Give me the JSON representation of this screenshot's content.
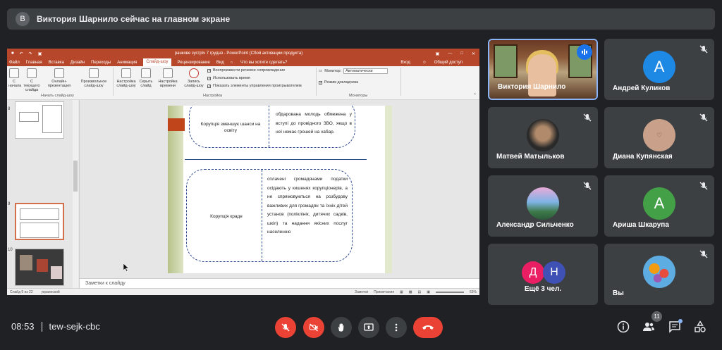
{
  "banner": {
    "avatar_letter": "В",
    "text": "Виктория Шарнило сейчас на главном экране"
  },
  "powerpoint": {
    "title": "ранкове зустріч 7 грудня - PowerPoint (Сбой активации продукта)",
    "menu": [
      {
        "label": "Файл"
      },
      {
        "label": "Главная"
      },
      {
        "label": "Вставка"
      },
      {
        "label": "Дизайн"
      },
      {
        "label": "Переходы"
      },
      {
        "label": "Анимация"
      },
      {
        "label": "Слайд-шоу",
        "active": true
      },
      {
        "label": "Рецензирование"
      },
      {
        "label": "Вид"
      },
      {
        "label": "Что вы хотите сделать?"
      }
    ],
    "menu_right": [
      "Вход",
      "Общий доступ"
    ],
    "ribbon": {
      "buttons": [
        "С начала",
        "С текущего слайда",
        "Онлайн-презентация",
        "Произвольное слайд-шоу",
        "Настройка слайд-шоу",
        "Скрыть слайд",
        "Настройка времени",
        "Запись слайд-шоу"
      ],
      "checks": [
        "Воспроизвести речевое сопровождение",
        "Использовать время",
        "Показать элементы управления проигрывателем"
      ],
      "monitor_label": "Монитор:",
      "monitor_value": "Автоматически",
      "presenter_view": "Режим докладчика",
      "groups": [
        "Начать слайд-шоу",
        "Настройка",
        "Мониторы"
      ]
    },
    "thumbnails": [
      {
        "num": "8"
      },
      {
        "num": "9"
      },
      {
        "num": "10"
      },
      {
        "num": "11"
      }
    ],
    "slide": {
      "row1_label": "Корупція зменшує шанси на освіту",
      "row1_text": "обдарована молодь обмежена у вступі до провідного ЗВО, якщо в неї немає грошей на хабар.",
      "row2_label": "Корупція краде",
      "row2_text": "сплачені громадянами податки осідають у кишенях корупціонерів, а не спрямовуються на розбудову важливих для громадян та їхніх дітей установ (поліклінік, дитячих садків, шкіл) та надання якісних послуг населенню"
    },
    "notes": "Заметки к слайду",
    "status_left": "Слайд 9 из 22",
    "status_lang": "украинский",
    "status_notes": "Заметки",
    "status_comments": "Примечания",
    "zoom": "63%"
  },
  "participants": [
    {
      "name": "Виктория Шарнило",
      "speaking": true
    },
    {
      "name": "Андрей Куликов",
      "letter": "А",
      "color": "#1e88e5"
    },
    {
      "name": "Матвей Матыльков"
    },
    {
      "name": "Диана Купянская"
    },
    {
      "name": "Александр Сильченко"
    },
    {
      "name": "Ариша Шкарупа",
      "letter": "А",
      "color": "#43a047"
    },
    {
      "name": "Ещё 3 чел.",
      "letters": [
        "Д",
        "Н"
      ],
      "colors": [
        "#e91e63",
        "#3f51b5"
      ]
    },
    {
      "name": "Вы"
    }
  ],
  "bottom": {
    "time": "08:53",
    "meeting_code": "tew-sejk-cbc",
    "participant_count": "11"
  }
}
